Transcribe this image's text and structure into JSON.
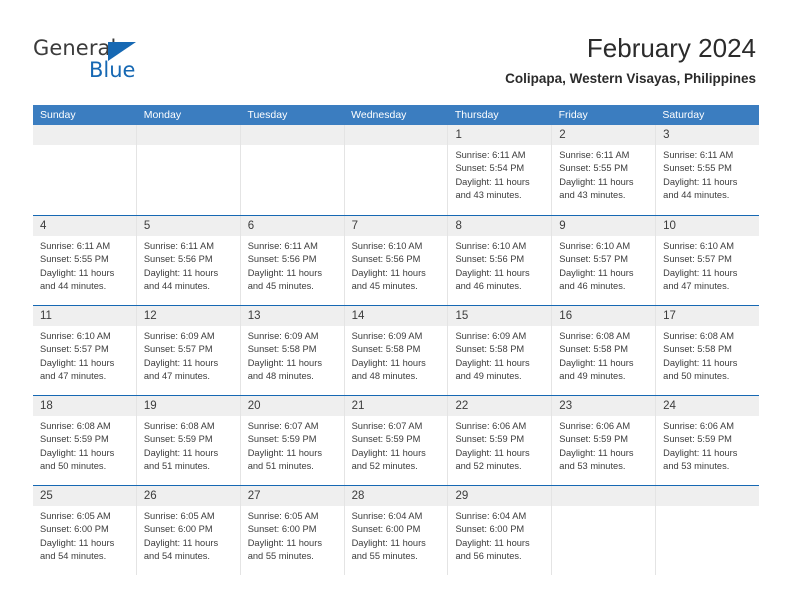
{
  "brand": {
    "name_part1": "General",
    "name_part2": "Blue",
    "accent_color": "#1668b3"
  },
  "header": {
    "title": "February 2024",
    "location": "Colipapa, Western Visayas, Philippines"
  },
  "calendar": {
    "header_bg": "#3b7dc0",
    "band_bg": "#efefef",
    "weekdays": [
      "Sunday",
      "Monday",
      "Tuesday",
      "Wednesday",
      "Thursday",
      "Friday",
      "Saturday"
    ],
    "weeks": [
      [
        {
          "day": "",
          "empty": true
        },
        {
          "day": "",
          "empty": true
        },
        {
          "day": "",
          "empty": true
        },
        {
          "day": "",
          "empty": true
        },
        {
          "day": "1",
          "sunrise": "Sunrise: 6:11 AM",
          "sunset": "Sunset: 5:54 PM",
          "daylight_line1": "Daylight: 11 hours",
          "daylight_line2": "and 43 minutes."
        },
        {
          "day": "2",
          "sunrise": "Sunrise: 6:11 AM",
          "sunset": "Sunset: 5:55 PM",
          "daylight_line1": "Daylight: 11 hours",
          "daylight_line2": "and 43 minutes."
        },
        {
          "day": "3",
          "sunrise": "Sunrise: 6:11 AM",
          "sunset": "Sunset: 5:55 PM",
          "daylight_line1": "Daylight: 11 hours",
          "daylight_line2": "and 44 minutes."
        }
      ],
      [
        {
          "day": "4",
          "sunrise": "Sunrise: 6:11 AM",
          "sunset": "Sunset: 5:55 PM",
          "daylight_line1": "Daylight: 11 hours",
          "daylight_line2": "and 44 minutes."
        },
        {
          "day": "5",
          "sunrise": "Sunrise: 6:11 AM",
          "sunset": "Sunset: 5:56 PM",
          "daylight_line1": "Daylight: 11 hours",
          "daylight_line2": "and 44 minutes."
        },
        {
          "day": "6",
          "sunrise": "Sunrise: 6:11 AM",
          "sunset": "Sunset: 5:56 PM",
          "daylight_line1": "Daylight: 11 hours",
          "daylight_line2": "and 45 minutes."
        },
        {
          "day": "7",
          "sunrise": "Sunrise: 6:10 AM",
          "sunset": "Sunset: 5:56 PM",
          "daylight_line1": "Daylight: 11 hours",
          "daylight_line2": "and 45 minutes."
        },
        {
          "day": "8",
          "sunrise": "Sunrise: 6:10 AM",
          "sunset": "Sunset: 5:56 PM",
          "daylight_line1": "Daylight: 11 hours",
          "daylight_line2": "and 46 minutes."
        },
        {
          "day": "9",
          "sunrise": "Sunrise: 6:10 AM",
          "sunset": "Sunset: 5:57 PM",
          "daylight_line1": "Daylight: 11 hours",
          "daylight_line2": "and 46 minutes."
        },
        {
          "day": "10",
          "sunrise": "Sunrise: 6:10 AM",
          "sunset": "Sunset: 5:57 PM",
          "daylight_line1": "Daylight: 11 hours",
          "daylight_line2": "and 47 minutes."
        }
      ],
      [
        {
          "day": "11",
          "sunrise": "Sunrise: 6:10 AM",
          "sunset": "Sunset: 5:57 PM",
          "daylight_line1": "Daylight: 11 hours",
          "daylight_line2": "and 47 minutes."
        },
        {
          "day": "12",
          "sunrise": "Sunrise: 6:09 AM",
          "sunset": "Sunset: 5:57 PM",
          "daylight_line1": "Daylight: 11 hours",
          "daylight_line2": "and 47 minutes."
        },
        {
          "day": "13",
          "sunrise": "Sunrise: 6:09 AM",
          "sunset": "Sunset: 5:58 PM",
          "daylight_line1": "Daylight: 11 hours",
          "daylight_line2": "and 48 minutes."
        },
        {
          "day": "14",
          "sunrise": "Sunrise: 6:09 AM",
          "sunset": "Sunset: 5:58 PM",
          "daylight_line1": "Daylight: 11 hours",
          "daylight_line2": "and 48 minutes."
        },
        {
          "day": "15",
          "sunrise": "Sunrise: 6:09 AM",
          "sunset": "Sunset: 5:58 PM",
          "daylight_line1": "Daylight: 11 hours",
          "daylight_line2": "and 49 minutes."
        },
        {
          "day": "16",
          "sunrise": "Sunrise: 6:08 AM",
          "sunset": "Sunset: 5:58 PM",
          "daylight_line1": "Daylight: 11 hours",
          "daylight_line2": "and 49 minutes."
        },
        {
          "day": "17",
          "sunrise": "Sunrise: 6:08 AM",
          "sunset": "Sunset: 5:58 PM",
          "daylight_line1": "Daylight: 11 hours",
          "daylight_line2": "and 50 minutes."
        }
      ],
      [
        {
          "day": "18",
          "sunrise": "Sunrise: 6:08 AM",
          "sunset": "Sunset: 5:59 PM",
          "daylight_line1": "Daylight: 11 hours",
          "daylight_line2": "and 50 minutes."
        },
        {
          "day": "19",
          "sunrise": "Sunrise: 6:08 AM",
          "sunset": "Sunset: 5:59 PM",
          "daylight_line1": "Daylight: 11 hours",
          "daylight_line2": "and 51 minutes."
        },
        {
          "day": "20",
          "sunrise": "Sunrise: 6:07 AM",
          "sunset": "Sunset: 5:59 PM",
          "daylight_line1": "Daylight: 11 hours",
          "daylight_line2": "and 51 minutes."
        },
        {
          "day": "21",
          "sunrise": "Sunrise: 6:07 AM",
          "sunset": "Sunset: 5:59 PM",
          "daylight_line1": "Daylight: 11 hours",
          "daylight_line2": "and 52 minutes."
        },
        {
          "day": "22",
          "sunrise": "Sunrise: 6:06 AM",
          "sunset": "Sunset: 5:59 PM",
          "daylight_line1": "Daylight: 11 hours",
          "daylight_line2": "and 52 minutes."
        },
        {
          "day": "23",
          "sunrise": "Sunrise: 6:06 AM",
          "sunset": "Sunset: 5:59 PM",
          "daylight_line1": "Daylight: 11 hours",
          "daylight_line2": "and 53 minutes."
        },
        {
          "day": "24",
          "sunrise": "Sunrise: 6:06 AM",
          "sunset": "Sunset: 5:59 PM",
          "daylight_line1": "Daylight: 11 hours",
          "daylight_line2": "and 53 minutes."
        }
      ],
      [
        {
          "day": "25",
          "sunrise": "Sunrise: 6:05 AM",
          "sunset": "Sunset: 6:00 PM",
          "daylight_line1": "Daylight: 11 hours",
          "daylight_line2": "and 54 minutes."
        },
        {
          "day": "26",
          "sunrise": "Sunrise: 6:05 AM",
          "sunset": "Sunset: 6:00 PM",
          "daylight_line1": "Daylight: 11 hours",
          "daylight_line2": "and 54 minutes."
        },
        {
          "day": "27",
          "sunrise": "Sunrise: 6:05 AM",
          "sunset": "Sunset: 6:00 PM",
          "daylight_line1": "Daylight: 11 hours",
          "daylight_line2": "and 55 minutes."
        },
        {
          "day": "28",
          "sunrise": "Sunrise: 6:04 AM",
          "sunset": "Sunset: 6:00 PM",
          "daylight_line1": "Daylight: 11 hours",
          "daylight_line2": "and 55 minutes."
        },
        {
          "day": "29",
          "sunrise": "Sunrise: 6:04 AM",
          "sunset": "Sunset: 6:00 PM",
          "daylight_line1": "Daylight: 11 hours",
          "daylight_line2": "and 56 minutes."
        },
        {
          "day": "",
          "empty": true
        },
        {
          "day": "",
          "empty": true
        }
      ]
    ]
  }
}
